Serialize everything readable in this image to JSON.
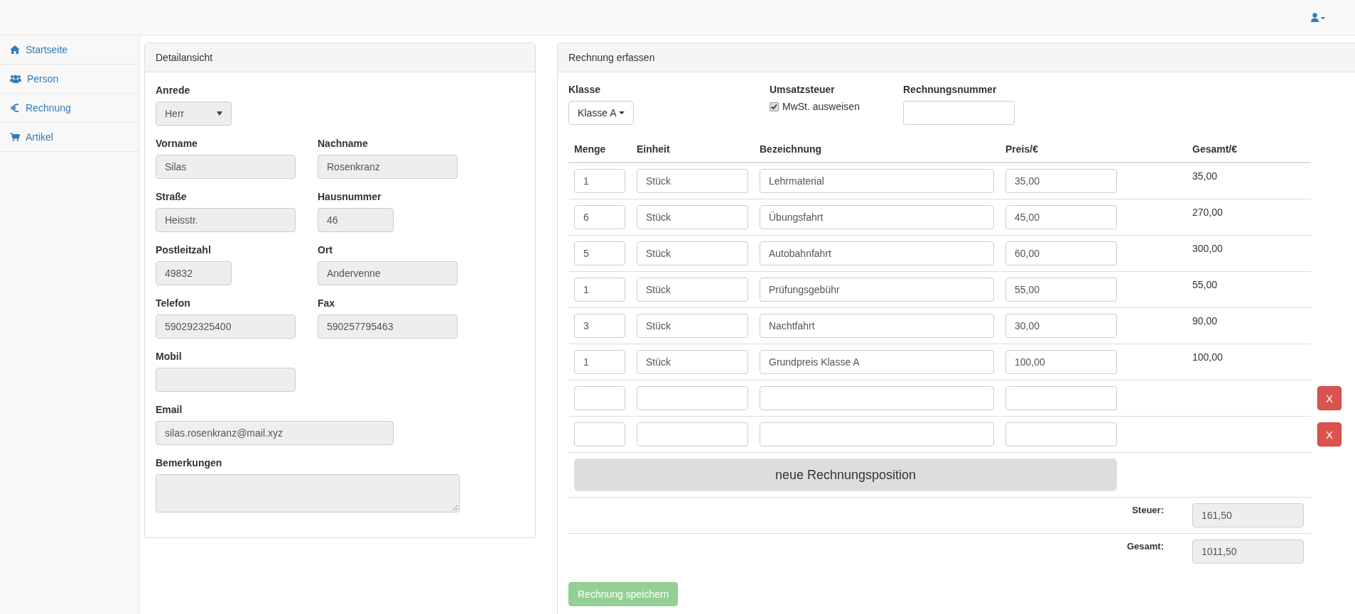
{
  "sidebar": {
    "items": [
      {
        "label": "Startseite"
      },
      {
        "label": "Person"
      },
      {
        "label": "Rechnung"
      },
      {
        "label": "Artikel"
      }
    ]
  },
  "detail_panel": {
    "title": "Detailansicht",
    "rows": [
      [
        {
          "kind": "select",
          "label": "Anrede",
          "value": "Herr",
          "disabled": true
        }
      ],
      [
        {
          "kind": "input",
          "label": "Vorname",
          "value": "Silas",
          "disabled": true
        },
        {
          "kind": "input",
          "label": "Nachname",
          "value": "Rosenkranz",
          "disabled": true
        }
      ],
      [
        {
          "kind": "input",
          "label": "Straße",
          "value": "Heisstr.",
          "disabled": true
        },
        {
          "kind": "input",
          "label": "Hausnummer",
          "value": "46",
          "disabled": true
        }
      ],
      [
        {
          "kind": "input",
          "label": "Postleitzahl",
          "value": "49832",
          "disabled": true
        },
        {
          "kind": "input",
          "label": "Ort",
          "value": "Andervenne",
          "disabled": true
        }
      ],
      [
        {
          "kind": "input",
          "label": "Telefon",
          "value": "590292325400",
          "disabled": true
        },
        {
          "kind": "input",
          "label": "Fax",
          "value": "590257795463",
          "disabled": true
        }
      ],
      [
        {
          "kind": "input",
          "label": "Mobil",
          "disabled": true
        }
      ],
      [
        {
          "kind": "input",
          "label": "Email",
          "value": "silas.rosenkranz@mail.xyz",
          "disabled": true
        }
      ],
      [
        {
          "kind": "textarea",
          "label": "Bemerkungen",
          "disabled": true
        }
      ]
    ]
  },
  "invoice_panel": {
    "title": "Rechnung erfassen",
    "klasse": {
      "label": "Klasse",
      "value": "Klasse A"
    },
    "umsatzsteuer": {
      "label": "Umsatzsteuer",
      "checkbox_label": "MwSt. ausweisen",
      "checked": true
    },
    "rechnungsnummer": {
      "label": "Rechnungsnummer"
    },
    "table": {
      "columns": [
        "Menge",
        "Einheit",
        "Bezeichnung",
        "Preis/€",
        "Gesamt/€"
      ],
      "rows": [
        {
          "menge": "1",
          "einheit": "Stück",
          "bezeichnung": "Lehrmaterial",
          "preis": "35,00",
          "gesamt": "35,00"
        },
        {
          "menge": "6",
          "einheit": "Stück",
          "bezeichnung": "Übungsfahrt",
          "preis": "45,00",
          "gesamt": "270,00"
        },
        {
          "menge": "5",
          "einheit": "Stück",
          "bezeichnung": "Autobahnfahrt",
          "preis": "60,00",
          "gesamt": "300,00"
        },
        {
          "menge": "1",
          "einheit": "Stück",
          "bezeichnung": "Prüfungsgebühr",
          "preis": "55,00",
          "gesamt": "55,00"
        },
        {
          "menge": "3",
          "einheit": "Stück",
          "bezeichnung": "Nachtfahrt",
          "preis": "30,00",
          "gesamt": "90,00"
        },
        {
          "menge": "1",
          "einheit": "Stück",
          "bezeichnung": "Grundpreis Klasse A",
          "preis": "100,00",
          "gesamt": "100,00"
        },
        {
          "delete_label": "X"
        },
        {
          "delete_label": "X"
        }
      ]
    },
    "add_button": "neue Rechnungsposition",
    "totals": [
      {
        "label": "Steuer:",
        "value": "161,50"
      },
      {
        "label": "Gesamt:",
        "value": "1011,50"
      }
    ],
    "save_button": {
      "label": "Rechnung speichern",
      "disabled": true
    }
  }
}
